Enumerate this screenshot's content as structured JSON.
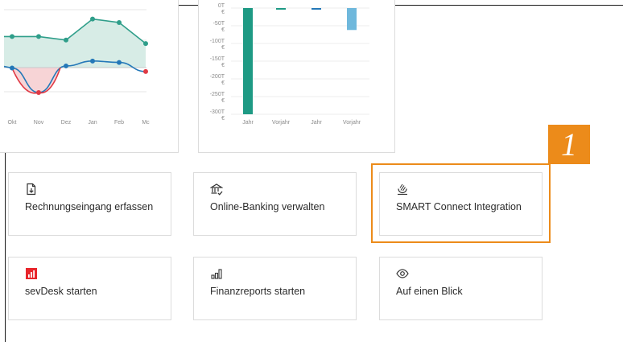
{
  "line_chart": {
    "months": [
      "Okt",
      "Nov",
      "Dez",
      "Jan",
      "Feb",
      "Mc"
    ],
    "colors": {
      "teal": "#2f9e8a",
      "blue": "#2478b8",
      "red": "#e03a45"
    }
  },
  "bar_chart": {
    "ticks": [
      "0T €",
      "-50T €",
      "-100T €",
      "-150T €",
      "-200T €",
      "-250T €",
      "-300T €"
    ],
    "categories": [
      "Jahr",
      "Vorjahr",
      "Jahr",
      "Vorjahr"
    ],
    "colors": [
      "#1e9a84",
      "#1e9a84",
      "#2478b8",
      "#6fb8dc"
    ]
  },
  "chart_data": [
    {
      "type": "line",
      "categories": [
        "Okt",
        "Nov",
        "Dez",
        "Jan",
        "Feb",
        "Mc"
      ],
      "xlabel": "",
      "ylabel": "",
      "series": [
        {
          "values": [
            1,
            1,
            0.95,
            1.25,
            1.2,
            0.9
          ]
        },
        {
          "values": [
            0.55,
            0.2,
            0.58,
            0.65,
            0.63,
            0.5
          ]
        }
      ],
      "legend": "none",
      "grid": true
    },
    {
      "type": "bar",
      "categories": [
        "Jahr",
        "Vorjahr",
        "Jahr",
        "Vorjahr"
      ],
      "values": [
        -300,
        -1,
        -3,
        -62
      ],
      "xlabel": "",
      "ylabel": "",
      "ylim": [
        -320,
        0
      ],
      "grid": true
    }
  ],
  "tiles": [
    {
      "label": "Rechnungseingang erfassen",
      "icon": "invoice-import-icon"
    },
    {
      "label": "Online-Banking verwalten",
      "icon": "bank-icon"
    },
    {
      "label": "SMART Connect Integration",
      "icon": "smart-connect-icon"
    },
    {
      "label": "sevDesk starten",
      "icon": "sevdesk-logo-icon",
      "icon_color": "#e8262c"
    },
    {
      "label": "Finanzreports starten",
      "icon": "bar-chart-icon"
    },
    {
      "label": "Auf einen Blick",
      "icon": "eye-icon"
    }
  ],
  "callout": {
    "number": "1",
    "color": "#ec8b1a"
  }
}
